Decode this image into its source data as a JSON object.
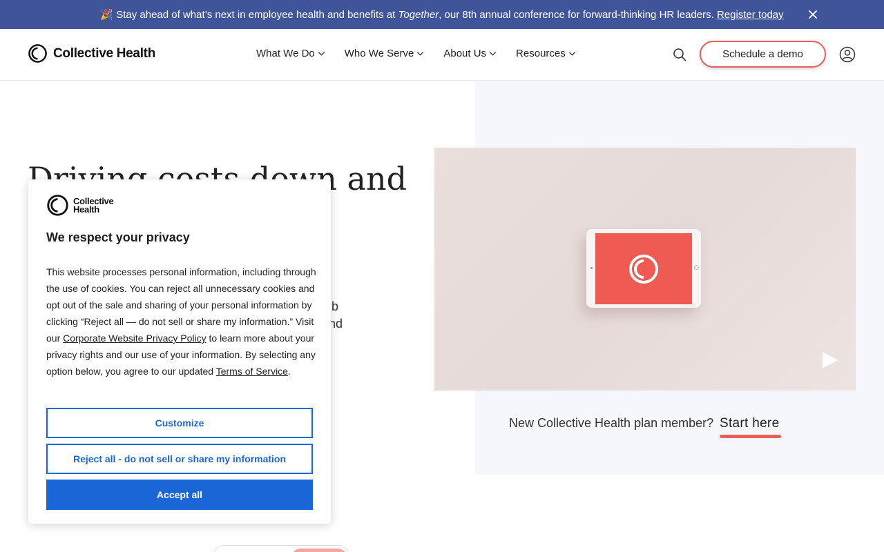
{
  "banner": {
    "emoji": "🎉",
    "text_before": "Stay ahead of what’s next in employee health and benefits at ",
    "event_name": "Together",
    "text_after": ", our 8th annual conference for forward-thinking HR leaders. ",
    "link_label": "Register today",
    "close_icon": "close-icon",
    "background": "#3f5499"
  },
  "header": {
    "logo_text": "Collective Health",
    "nav": [
      {
        "label": "What We Do"
      },
      {
        "label": "Who We Serve"
      },
      {
        "label": "About Us"
      },
      {
        "label": "Resources"
      }
    ],
    "search_icon": "search-icon",
    "cta_label": "Schedule a demo",
    "account_icon": "user-account-icon",
    "accent": "#e7605a"
  },
  "hero": {
    "headline_partial": "Driving costs down and",
    "text_fragment_1": "ub",
    "text_fragment_2": "nd",
    "video_play_icon": "play-icon",
    "member_prompt": "New Collective Health plan member?",
    "member_link": "Start here"
  },
  "cookie_dialog": {
    "logo_line1": "Collective",
    "logo_line2": "Health",
    "title": "We respect your privacy",
    "body_part1": "This website processes personal information, including through the use of cookies. You can reject all unnecessary cookies and opt out of the sale and sharing of your personal information by clicking “Reject all — do not sell or share my information.” Visit our ",
    "policy_link": "Corporate Website Privacy Policy",
    "body_part2": " to learn more about your privacy rights and our use of your information. By selecting any option below, you agree to our updated ",
    "terms_link": "Terms of Service",
    "body_part3": ".",
    "customize_label": "Customize",
    "reject_label": "Reject all - do not sell or share my information",
    "accept_label": "Accept all",
    "button_color": "#1a66d6"
  }
}
